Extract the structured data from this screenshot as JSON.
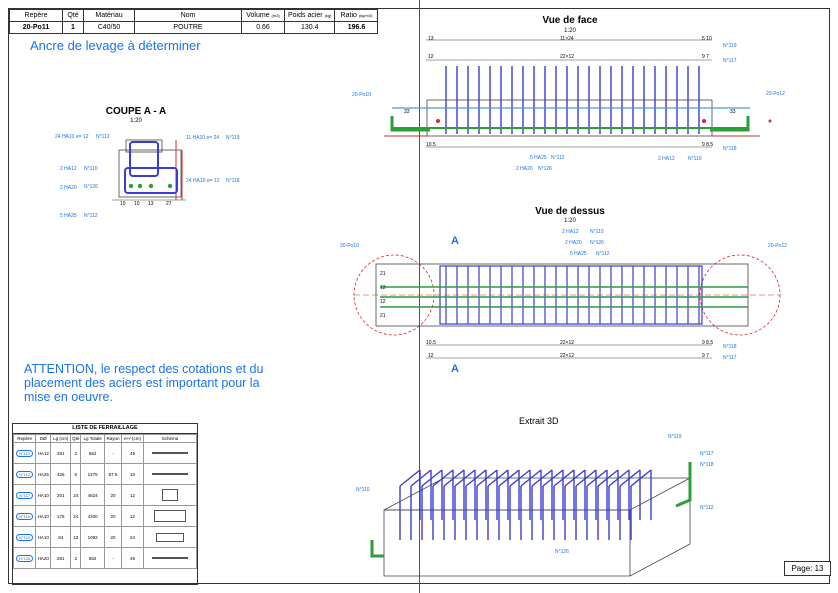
{
  "title_block": {
    "headers": [
      "Repère",
      "Qté",
      "Matériau",
      "Nom",
      "Volume",
      "Poids acier",
      "Ratio"
    ],
    "header_units": [
      "",
      "",
      "",
      "",
      "(m3)",
      "(kg)",
      "(kg/m3)"
    ],
    "values": [
      "20-Po11",
      "1",
      "C40/50",
      "POUTRE",
      "0.66",
      "130.4",
      "196.6"
    ]
  },
  "notes": {
    "lifting_anchor": "Ancre de levage à déterminer",
    "attention": "ATTENTION, le respect des cotations et du placement des aciers est important pour la mise en oeuvre."
  },
  "views": {
    "section": {
      "title": "COUPE  A - A",
      "scale": "1:20"
    },
    "front": {
      "title": "Vue de face",
      "scale": "1:20"
    },
    "top": {
      "title": "Vue de dessus",
      "scale": "1:20"
    },
    "extract": {
      "title": "Extrait 3D"
    }
  },
  "section_labels": {
    "l1": "24 HA10 e= 12",
    "r1": "N°112",
    "l2": "11 HA10 e= 24",
    "r2": "N°119",
    "l3": "2 HA12",
    "r3": "N°110",
    "l4": "2 HA20",
    "r4": "N°126",
    "l5": "24 HA10 e= 12",
    "r5": "N°118",
    "l6": "5 HA25",
    "r6": "N°112",
    "dims": [
      "10",
      "10",
      "13",
      "27"
    ]
  },
  "front_labels": {
    "top_dim1": "13",
    "top_dim2": "11×24",
    "top_dim3": "5 10",
    "top_dim4": "12",
    "top_dim5": "22×12",
    "top_dim6": "9 7",
    "n119": "N°119",
    "n117": "N°117",
    "left_ref": "20-Po10",
    "right_ref": "20-Po12",
    "side_dim": "33",
    "bot_dim1": "10.5",
    "bot_dim2": "9 8.5",
    "n118": "N°118",
    "b1": "5 HA25",
    "b1n": "N°112",
    "b2": "2 HA20",
    "b2n": "N°126",
    "b3": "2 HA12",
    "b3n": "N°110"
  },
  "top_labels": {
    "t1": "2 HA12",
    "t1n": "N°110",
    "t2": "2 HA20",
    "t2n": "N°126",
    "t3": "5 HA25",
    "t3n": "N°112",
    "left_ref": "20-Po10",
    "right_ref": "20-Po12",
    "section_mark": "A",
    "d1": "10.5",
    "d2": "22×12",
    "d3": "9 8.5",
    "n118": "N°118",
    "d4": "12",
    "d5": "22×12",
    "d6": "9 7",
    "n117": "N°117",
    "side": [
      "21",
      "12",
      "12",
      "21"
    ]
  },
  "extract_labels": [
    "N°119",
    "N°117",
    "N°118",
    "N°110",
    "N°112",
    "N°126"
  ],
  "rebar_list": {
    "title": "LISTE DE FERRAILLAGE",
    "headers": [
      "Repère",
      "DØ",
      "Lg (cm)",
      "Qté",
      "Lg Totale",
      "Rayon",
      "e+/-(cm)",
      "Schéma"
    ],
    "rows": [
      [
        "N°110",
        "HA12",
        "281",
        "2",
        "562",
        "-",
        "49"
      ],
      [
        "N°112",
        "HA25",
        "426",
        "5",
        "1275",
        "87.5",
        "10"
      ],
      [
        "N°117",
        "HA10",
        "201",
        "24",
        "4824",
        "20",
        "12"
      ],
      [
        "N°118",
        "HA10",
        "175",
        "24",
        "4200",
        "20",
        "12"
      ],
      [
        "N°119",
        "HA10",
        "84",
        "13",
        "1092",
        "20",
        "24"
      ],
      [
        "N°126",
        "HA20",
        "281",
        "2",
        "562",
        "-",
        "49"
      ]
    ]
  },
  "page": {
    "label": "Page:",
    "number": "13"
  },
  "colors": {
    "annotation": "#1a73e8",
    "rebar": "#3b3bd6",
    "green_bar": "#2e9e3a",
    "section_red": "#d62b2b"
  }
}
